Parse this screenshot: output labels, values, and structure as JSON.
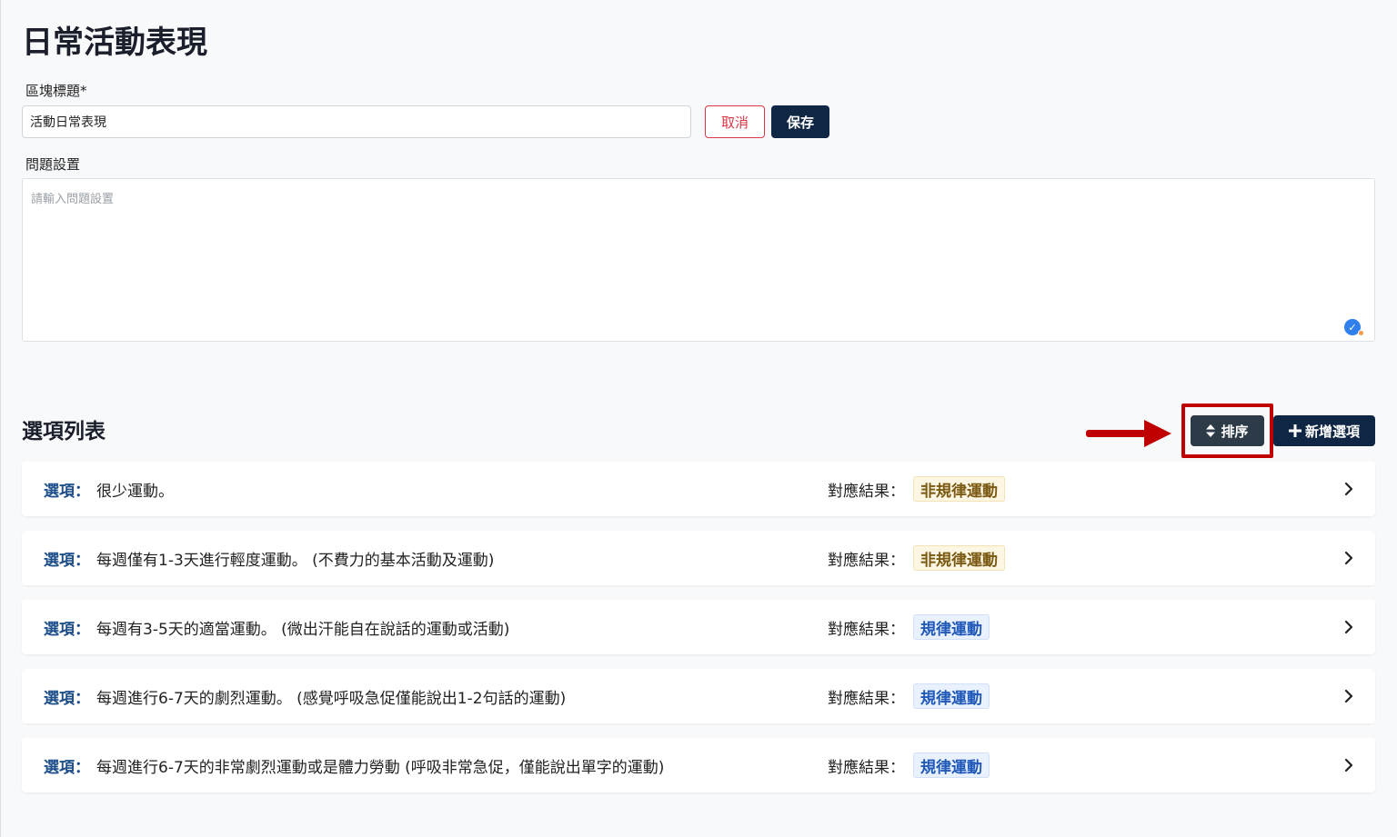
{
  "page": {
    "title": "日常活動表現"
  },
  "block_title": {
    "label": "區塊標題*",
    "value": "活動日常表現"
  },
  "actions": {
    "cancel_label": "取消",
    "save_label": "保存"
  },
  "question": {
    "label": "問題設置",
    "placeholder": "請輸入問題設置"
  },
  "options_section": {
    "title": "選項列表",
    "sort_label": "排序",
    "add_label": "新增選項"
  },
  "options": [
    {
      "label": "選項：",
      "text": "很少運動。",
      "result_label": "對應結果：",
      "result": "非規律運動",
      "result_kind": "irregular"
    },
    {
      "label": "選項：",
      "text": "每週僅有1-3天進行輕度運動。 (不費力的基本活動及運動)",
      "result_label": "對應結果：",
      "result": "非規律運動",
      "result_kind": "irregular"
    },
    {
      "label": "選項：",
      "text": "每週有3-5天的適當運動。 (微出汗能自在說話的運動或活動)",
      "result_label": "對應結果：",
      "result": "規律運動",
      "result_kind": "regular"
    },
    {
      "label": "選項：",
      "text": "每週進行6-7天的劇烈運動。 (感覺呼吸急促僅能說出1-2句話的運動)",
      "result_label": "對應結果：",
      "result": "規律運動",
      "result_kind": "regular"
    },
    {
      "label": "選項：",
      "text": "每週進行6-7天的非常劇烈運動或是體力勞動 (呼吸非常急促，僅能說出單字的運動)",
      "result_label": "對應結果：",
      "result": "規律運動",
      "result_kind": "regular"
    }
  ],
  "colors": {
    "primary_navy": "#0f2744",
    "danger": "#dc3545",
    "highlight_red": "#c00000",
    "option_label_blue": "#1d4e89"
  }
}
